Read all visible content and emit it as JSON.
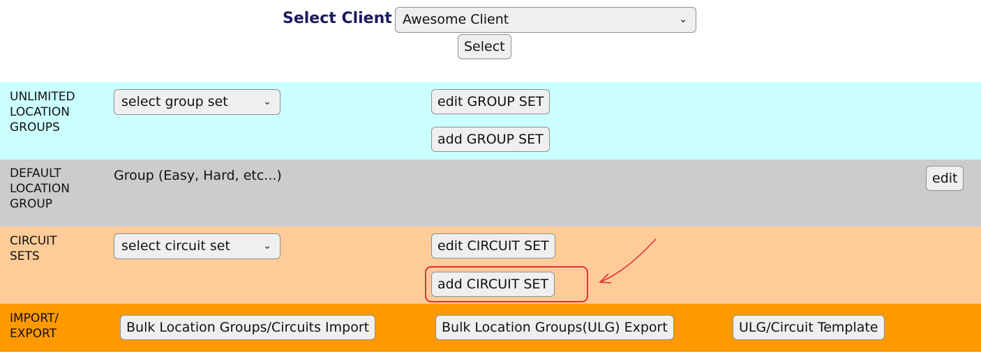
{
  "header": {
    "select_client_label": "Select Client",
    "client_value": "Awesome Client",
    "select_button": "Select"
  },
  "rows": {
    "ulg": {
      "label_lines": [
        "UNLIMITED",
        "LOCATION",
        "GROUPS"
      ],
      "dropdown": "select group set",
      "edit_button": "edit GROUP SET",
      "add_button": "add GROUP SET",
      "bg": "#ccffff"
    },
    "default": {
      "label_lines": [
        "DEFAULT",
        "LOCATION",
        "GROUP"
      ],
      "value": "Group (Easy, Hard, etc...)",
      "edit_button": "edit",
      "bg": "#cccccc"
    },
    "circuit": {
      "label_lines": [
        "CIRCUIT",
        "SETS"
      ],
      "dropdown": "select circuit set",
      "edit_button": "edit CIRCUIT SET",
      "add_button": "add CIRCUIT SET",
      "bg": "#ffcc99"
    },
    "import": {
      "label_lines": [
        "IMPORT/",
        "EXPORT"
      ],
      "bulk_import_button": "Bulk Location Groups/Circuits Import",
      "bulk_export_button": "Bulk Location Groups(ULG) Export",
      "template_button": "ULG/Circuit Template",
      "bg": "#ff9900"
    }
  },
  "annotation": {
    "color": "#e03030"
  },
  "icons": {
    "dropdown": "chevron-down-icon"
  }
}
